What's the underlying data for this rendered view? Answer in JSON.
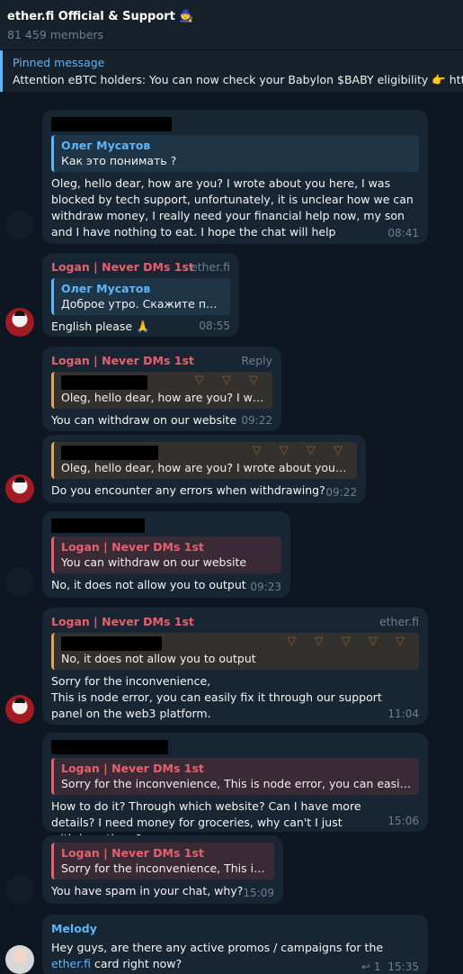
{
  "header": {
    "title": "ether.fi Official & Support 🧙",
    "members": "81 459 members"
  },
  "pinned": {
    "label": "Pinned message",
    "text": "Attention eBTC holders: You can now check your Babylon $BABY eligibility  👉 https"
  },
  "messages": [
    {
      "quote_name": "Олег Мусатов",
      "quote_text": "Как это понимать ?",
      "text": "Oleg, hello dear, how are you? I wrote about you here, I was blocked by tech support, unfortunately, it is unclear how we can withdraw money, I really need your financial help now, my son and I have nothing to eat. I hope the chat will help",
      "time": "08:41"
    },
    {
      "sender": "Logan | Never DMs 1st",
      "tag": "ether.fi",
      "quote_name": "Олег Мусатов",
      "quote_text": "Доброе утро. Скажите пож...",
      "text": "English please 🙏",
      "time": "08:55"
    },
    {
      "sender": "Logan | Never DMs 1st",
      "tag": "Reply",
      "quote_text": "Oleg, hello dear, how are you? I wro...",
      "text": "You can withdraw on our website",
      "time": "09:22"
    },
    {
      "quote_text": "Oleg, hello dear, how are you? I wrote about you he...",
      "text": "Do you encounter any errors when withdrawing?",
      "time": "09:22"
    },
    {
      "quote_name": "Logan | Never DMs 1st",
      "quote_text": "You can withdraw on our website",
      "text": "No, it does not allow you to output",
      "time": "09:23"
    },
    {
      "sender": "Logan | Never DMs 1st",
      "tag": "ether.fi",
      "quote_text": "No, it does not allow you to output",
      "text_line1": "Sorry for the inconvenience,",
      "text_line2": "This is node error, you can easily fix it through our support panel on the web3 platform.",
      "time": "11:04"
    },
    {
      "quote_name": "Logan | Never DMs 1st",
      "quote_text": "Sorry for the inconvenience, This is node error, you can easily ...",
      "text": "How to do it? Through which website? Can I have more details? I need money for groceries, why can't I just withdraw them?",
      "time": "15:06"
    },
    {
      "quote_name": "Logan | Never DMs 1st",
      "quote_text": "Sorry for the inconvenience, This is ...",
      "text": "You have spam in your chat, why?",
      "time": "15:09"
    },
    {
      "sender": "Melody",
      "text_before": "Hey guys, are there any active promos / campaigns for the ",
      "link": "ether.fi",
      "text_after": " card right now?",
      "replies": "↩ 1",
      "time": "15:35"
    }
  ],
  "colors": {
    "background": "#0e1621",
    "bubble": "#182533",
    "accent_blue": "#5eb5f7",
    "accent_red": "#e5616d"
  }
}
